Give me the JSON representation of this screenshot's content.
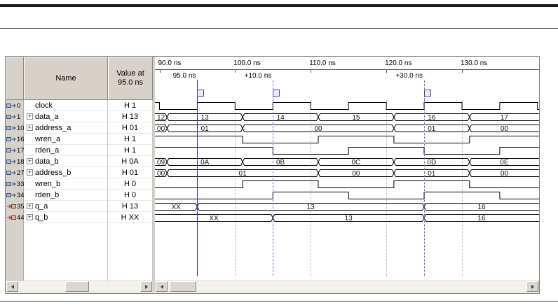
{
  "colors": {
    "cursor": "#2b36a0",
    "marker": "#4550b8",
    "grid": "#a9b0c8",
    "wave": "#000000",
    "header_bg": "#d6d2ca"
  },
  "icons": {
    "expand_plus": "+"
  },
  "window": {
    "columns": {
      "name_header": "Name",
      "value_header_line1": "Value at",
      "value_header_line2": "95.0 ns"
    },
    "timeline": {
      "start_ns": 89.4,
      "end_ns": 140.2,
      "ticks": [
        {
          "t": 90,
          "label": "90.0 ns"
        },
        {
          "t": 100,
          "label": "100.0 ns"
        },
        {
          "t": 110,
          "label": "110.0 ns"
        },
        {
          "t": 120,
          "label": "120.0 ns"
        },
        {
          "t": 130,
          "label": "130.0 ns"
        }
      ],
      "grid_ticks": [
        100,
        110,
        120,
        130
      ]
    },
    "markers": [
      {
        "t": 95,
        "label": "95.0 ns",
        "solid": true
      },
      {
        "t": 105,
        "label": "+10.0 ns",
        "solid": false
      },
      {
        "t": 125,
        "label": "+30.0 ns",
        "solid": false
      }
    ],
    "signals": [
      {
        "id": "0",
        "name": "clock",
        "icon": "input-pin-icon",
        "expandable": false,
        "value": "H 1",
        "type": "bit",
        "segments": [
          [
            89.4,
            90,
            "1"
          ],
          [
            90,
            95,
            "0"
          ],
          [
            95,
            100,
            "1"
          ],
          [
            100,
            105,
            "0"
          ],
          [
            105,
            110,
            "1"
          ],
          [
            110,
            115,
            "0"
          ],
          [
            115,
            120,
            "1"
          ],
          [
            120,
            125,
            "0"
          ],
          [
            125,
            130,
            "1"
          ],
          [
            130,
            135,
            "0"
          ],
          [
            135,
            140,
            "1"
          ],
          [
            140,
            140.2,
            "0"
          ]
        ]
      },
      {
        "id": "1",
        "name": "data_a",
        "icon": "input-pin-icon",
        "expandable": true,
        "value": "H 13",
        "type": "bus",
        "segments": [
          [
            89.4,
            91,
            "12"
          ],
          [
            91,
            101,
            "13"
          ],
          [
            101,
            111,
            "14"
          ],
          [
            111,
            121,
            "15"
          ],
          [
            121,
            131,
            "16"
          ],
          [
            131,
            140.2,
            "17"
          ]
        ]
      },
      {
        "id": "10",
        "name": "address_a",
        "icon": "input-pin-icon",
        "expandable": true,
        "value": "H 01",
        "type": "bus",
        "segments": [
          [
            89.4,
            91,
            "00"
          ],
          [
            91,
            101,
            "01"
          ],
          [
            101,
            121,
            "00"
          ],
          [
            121,
            131,
            "01"
          ],
          [
            131,
            140.2,
            "00"
          ]
        ]
      },
      {
        "id": "16",
        "name": "wren_a",
        "icon": "input-pin-icon",
        "expandable": false,
        "value": "H 1",
        "type": "bit",
        "segments": [
          [
            89.4,
            101,
            "1"
          ],
          [
            101,
            111,
            "0"
          ],
          [
            111,
            121,
            "1"
          ],
          [
            121,
            131,
            "0"
          ],
          [
            131,
            140.2,
            "1"
          ]
        ]
      },
      {
        "id": "17",
        "name": "rden_a",
        "icon": "input-pin-icon",
        "expandable": false,
        "value": "H 1",
        "type": "bit",
        "segments": [
          [
            89.4,
            105,
            "1"
          ],
          [
            105,
            115,
            "0"
          ],
          [
            115,
            125,
            "1"
          ],
          [
            125,
            135,
            "0"
          ],
          [
            135,
            140.2,
            "1"
          ]
        ]
      },
      {
        "id": "18",
        "name": "data_b",
        "icon": "input-pin-icon",
        "expandable": true,
        "value": "H 0A",
        "type": "bus",
        "segments": [
          [
            89.4,
            91,
            "09"
          ],
          [
            91,
            101,
            "0A"
          ],
          [
            101,
            111,
            "0B"
          ],
          [
            111,
            121,
            "0C"
          ],
          [
            121,
            131,
            "0D"
          ],
          [
            131,
            140.2,
            "0E"
          ]
        ]
      },
      {
        "id": "27",
        "name": "address_b",
        "icon": "input-pin-icon",
        "expandable": true,
        "value": "H 01",
        "type": "bus",
        "segments": [
          [
            89.4,
            91,
            "00"
          ],
          [
            91,
            111,
            "01"
          ],
          [
            111,
            121,
            "00"
          ],
          [
            121,
            131,
            "01"
          ],
          [
            131,
            140.2,
            "00"
          ]
        ]
      },
      {
        "id": "33",
        "name": "wren_b",
        "icon": "input-pin-icon",
        "expandable": false,
        "value": "H 0",
        "type": "bit",
        "segments": [
          [
            89.4,
            101,
            "0"
          ],
          [
            101,
            111,
            "1"
          ],
          [
            111,
            121,
            "0"
          ],
          [
            121,
            131,
            "1"
          ],
          [
            131,
            140.2,
            "0"
          ]
        ]
      },
      {
        "id": "34",
        "name": "rden_b",
        "icon": "input-pin-icon",
        "expandable": false,
        "value": "H 0",
        "type": "bit",
        "segments": [
          [
            89.4,
            105,
            "0"
          ],
          [
            105,
            115,
            "1"
          ],
          [
            115,
            125,
            "0"
          ],
          [
            125,
            135,
            "1"
          ],
          [
            135,
            140.2,
            "0"
          ]
        ]
      },
      {
        "id": "35",
        "name": "q_a",
        "icon": "output-pin-icon",
        "expandable": true,
        "value": "H 13",
        "type": "bus",
        "segments": [
          [
            89.4,
            95,
            "XX"
          ],
          [
            95,
            125,
            "13"
          ],
          [
            125,
            140.2,
            "16"
          ]
        ]
      },
      {
        "id": "44",
        "name": "q_b",
        "icon": "output-pin-icon",
        "expandable": true,
        "value": "H XX",
        "type": "bus",
        "segments": [
          [
            89.4,
            105,
            "XX"
          ],
          [
            105,
            125,
            "13"
          ],
          [
            125,
            140.2,
            "16"
          ]
        ]
      }
    ]
  }
}
